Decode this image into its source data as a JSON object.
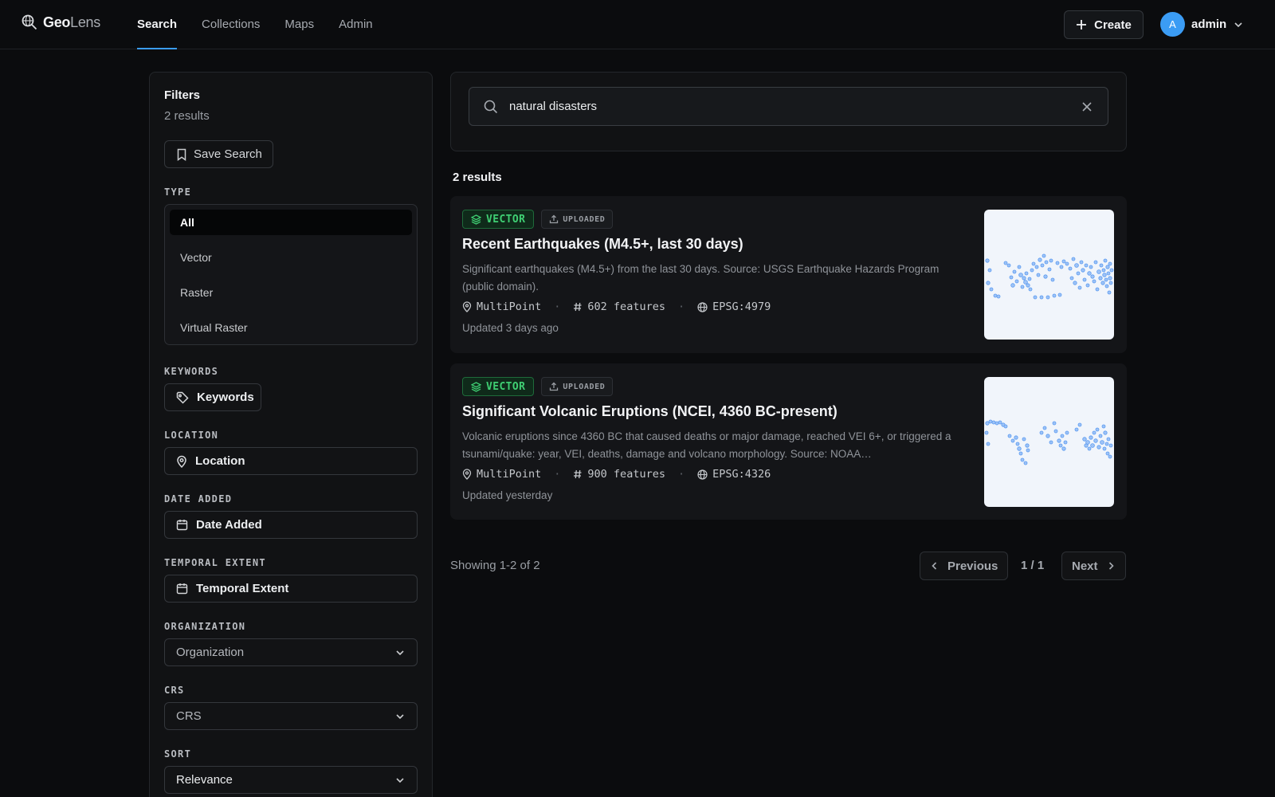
{
  "app": {
    "logo_bold": "Geo",
    "logo_light": "Lens"
  },
  "nav": {
    "tabs": [
      "Search",
      "Collections",
      "Maps",
      "Admin"
    ],
    "active": "Search"
  },
  "header": {
    "create_label": "Create",
    "user_initial": "A",
    "user_name": "admin"
  },
  "filters": {
    "title": "Filters",
    "count": "2 results",
    "save_label": "Save Search",
    "type_label": "TYPE",
    "types": [
      "All",
      "Vector",
      "Raster",
      "Virtual Raster"
    ],
    "selected_type": "All",
    "keywords_label": "KEYWORDS",
    "keywords_button": "Keywords",
    "location_label": "LOCATION",
    "location_button": "Location",
    "date_label": "DATE ADDED",
    "date_button": "Date Added",
    "temporal_label": "TEMPORAL EXTENT",
    "temporal_button": "Temporal Extent",
    "org_label": "ORGANIZATION",
    "org_placeholder": "Organization",
    "crs_label": "CRS",
    "crs_placeholder": "CRS",
    "sort_label": "SORT",
    "sort_value": "Relevance"
  },
  "search": {
    "value": "natural disasters"
  },
  "results": {
    "heading": "2 results",
    "items": [
      {
        "badge_type": "VECTOR",
        "badge_source": "UPLOADED",
        "title": "Recent Earthquakes (M4.5+, last 30 days)",
        "description": "Significant earthquakes (M4.5+) from the last 30 days. Source: USGS Earthquake Hazards Program (public domain).",
        "geometry": "MultiPoint",
        "features": "602 features",
        "crs": "EPSG:4979",
        "updated": "Updated 3 days ago"
      },
      {
        "badge_type": "VECTOR",
        "badge_source": "UPLOADED",
        "title": "Significant Volcanic Eruptions (NCEI, 4360 BC-present)",
        "description": "Volcanic eruptions since 4360 BC that caused deaths or major damage, reached VEI 6+, or triggered a tsunami/quake: year, VEI, deaths, damage and volcano morphology. Source: NOAA…",
        "geometry": "MultiPoint",
        "features": "900 features",
        "crs": "EPSG:4326",
        "updated": "Updated yesterday"
      }
    ]
  },
  "pagination": {
    "showing": "Showing 1-2 of 2",
    "previous": "Previous",
    "page": "1 / 1",
    "next": "Next"
  },
  "colors": {
    "accent": "#3b9cf4",
    "vector_badge": "#3fcf73",
    "background": "#0b0c0e"
  },
  "icons": {
    "logo": "magnifier-globe-icon",
    "create": "plus-icon",
    "user_menu": "chevron-down-icon",
    "save": "bookmark-icon",
    "keywords": "tag-icon",
    "location": "map-pin-icon",
    "date": "calendar-icon",
    "search": "search-icon",
    "clear": "close-icon",
    "vector": "layers-icon",
    "uploaded": "upload-icon",
    "geometry": "map-pin-icon",
    "features": "hash-icon",
    "crs": "globe-icon"
  }
}
